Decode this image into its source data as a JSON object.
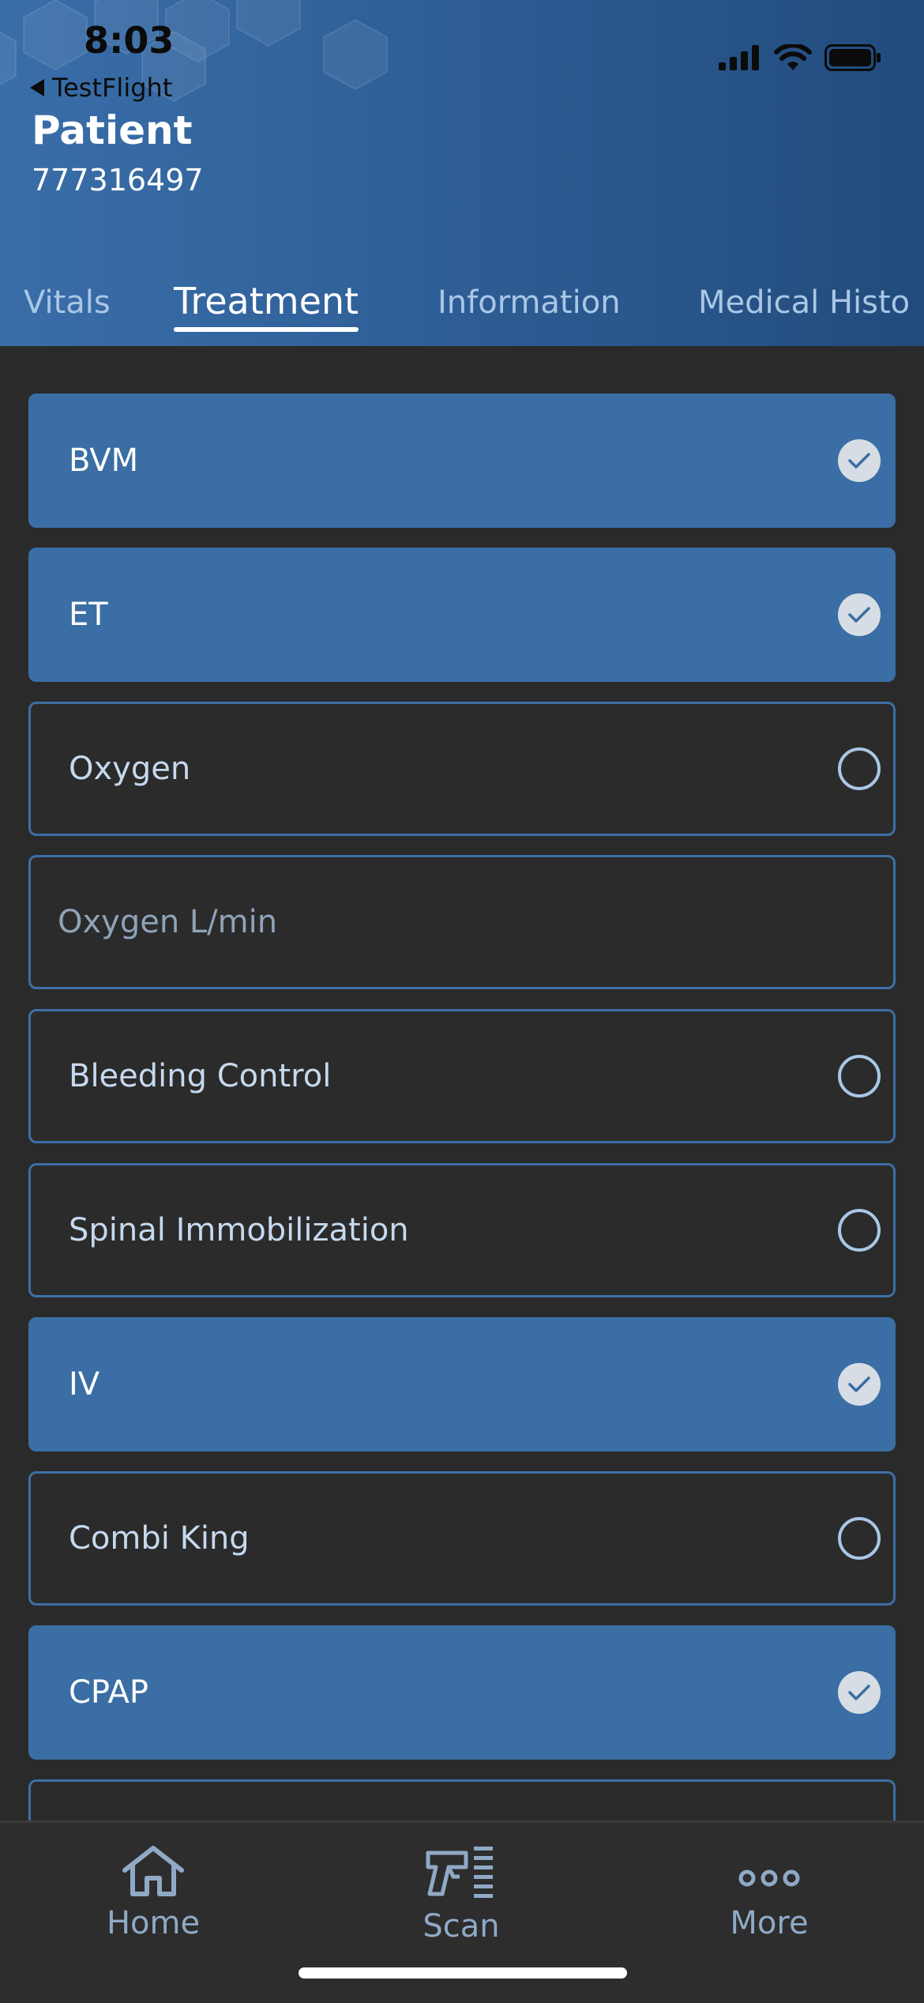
{
  "status_bar": {
    "time": "8:03",
    "back_app": "TestFlight"
  },
  "header": {
    "title": "Patient",
    "patient_id": "777316497"
  },
  "tabs": [
    {
      "label": "Vitals",
      "active": false
    },
    {
      "label": "Treatment",
      "active": true
    },
    {
      "label": "Information",
      "active": false
    },
    {
      "label": "Medical Histo",
      "active": false
    }
  ],
  "treatments": [
    {
      "label": "BVM",
      "checked": true
    },
    {
      "label": "ET",
      "checked": true
    },
    {
      "label": "Oxygen",
      "checked": false
    },
    {
      "label": "Bleeding Control",
      "checked": false
    },
    {
      "label": "Spinal Immobilization",
      "checked": false
    },
    {
      "label": "IV",
      "checked": true
    },
    {
      "label": "Combi King",
      "checked": false
    },
    {
      "label": "CPAP",
      "checked": true
    }
  ],
  "oxygen_input": {
    "placeholder": "Oxygen L/min",
    "value": ""
  },
  "bottom_nav": {
    "home": "Home",
    "scan": "Scan",
    "more": "More"
  },
  "colors": {
    "accent": "#3a6ea4",
    "background": "#2a2a2a",
    "outline": "#3d6fa6"
  }
}
